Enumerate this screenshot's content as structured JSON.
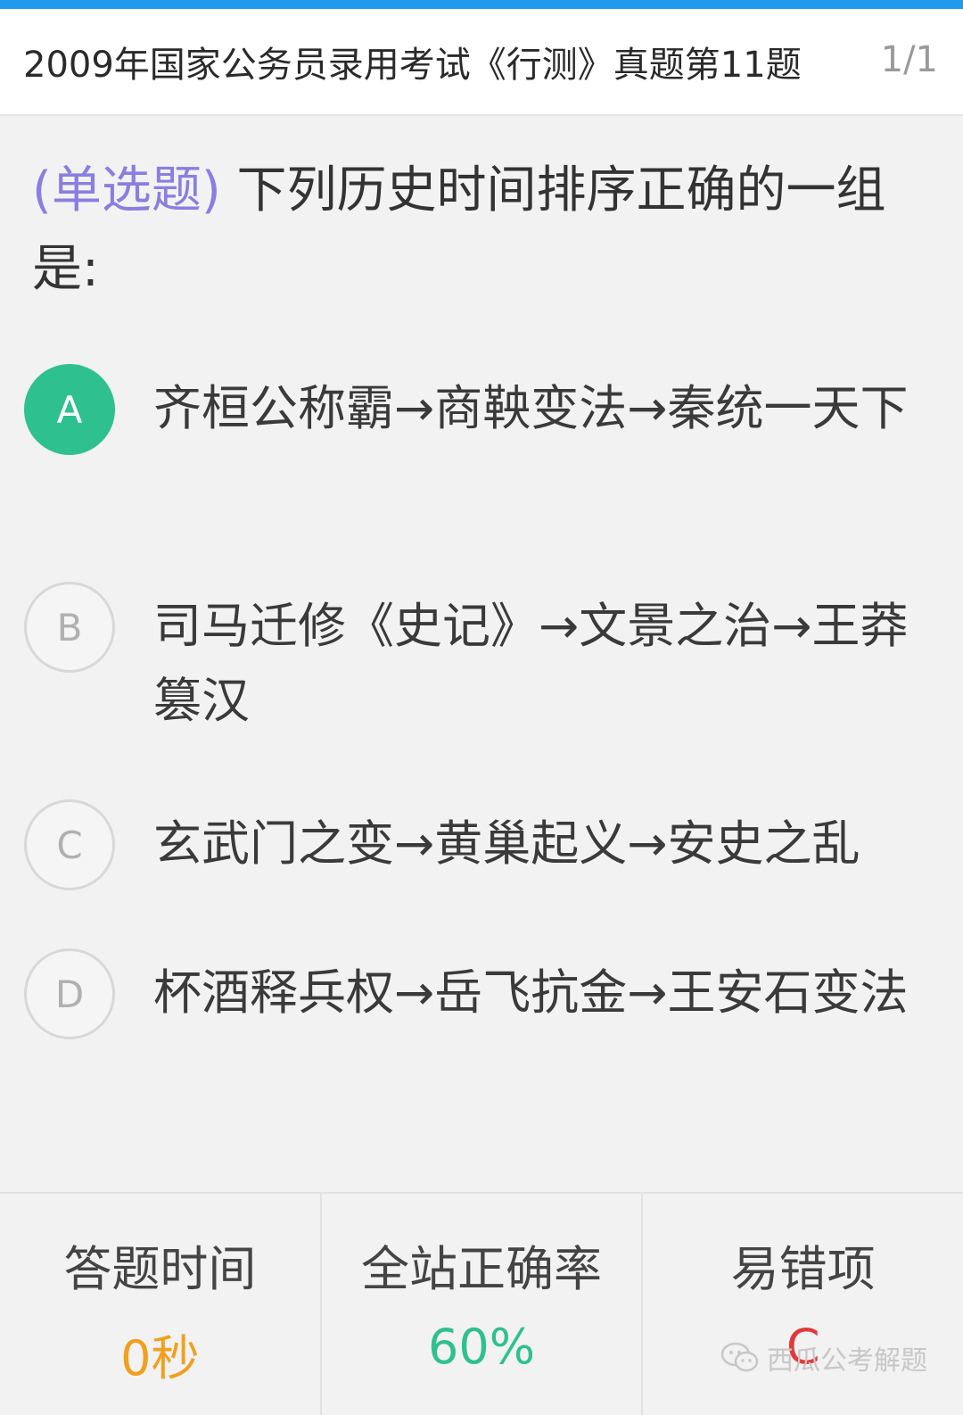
{
  "header": {
    "title": "2009年国家公务员录用考试《行测》真题第11题",
    "page_indicator": "1/1"
  },
  "question": {
    "type_label": "(单选题)",
    "text": " 下列历史时间排序正确的一组是:"
  },
  "options": [
    {
      "letter": "A",
      "text": "齐桓公称霸→商鞅变法→秦统一天下",
      "selected": true
    },
    {
      "letter": "B",
      "text": "司马迁修《史记》→文景之治→王莽篡汉",
      "selected": false
    },
    {
      "letter": "C",
      "text": "玄武门之变→黄巢起义→安史之乱",
      "selected": false
    },
    {
      "letter": "D",
      "text": "杯酒释兵权→岳飞抗金→王安石变法",
      "selected": false
    }
  ],
  "stats": {
    "time_label": "答题时间",
    "time_value": "0秒",
    "rate_label": "全站正确率",
    "rate_value": "60%",
    "wrong_label": "易错项",
    "wrong_value": "C"
  },
  "watermark": {
    "text": "西瓜公考解题",
    "icon": "wechat-icon"
  },
  "colors": {
    "accent_bar": "#1e9bea",
    "selected_option": "#2fc08f",
    "question_type": "#8a7ee0",
    "time_value": "#f0a020",
    "rate_value": "#2fc08f",
    "wrong_value": "#e03a3a"
  }
}
